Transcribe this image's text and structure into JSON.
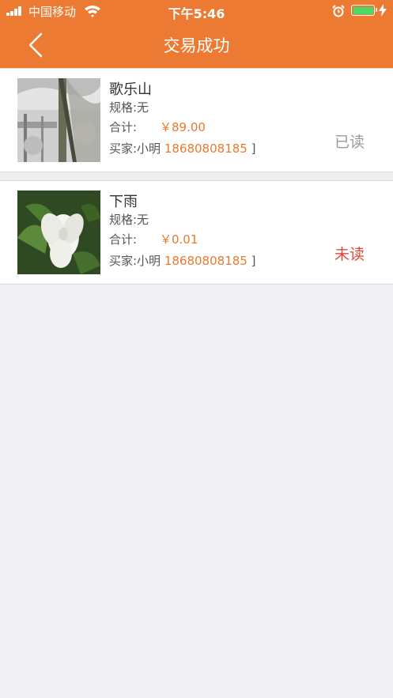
{
  "status_bar": {
    "carrier": "中国移动",
    "time": "下午5:46"
  },
  "header": {
    "title": "交易成功"
  },
  "orders": [
    {
      "name": "歌乐山",
      "spec": "规格:无",
      "total_label": "合计:",
      "price": "￥89.00",
      "buyer_label": "买家:小明",
      "buyer_phone": "18680808185",
      "buyer_suffix": "]",
      "read_status": "已读",
      "read_color": "#9a9a9a"
    },
    {
      "name": "下雨",
      "spec": "规格:无",
      "total_label": "合计:",
      "price": "￥0.01",
      "buyer_label": "买家:小明",
      "buyer_phone": "18680808185",
      "buyer_suffix": "]",
      "read_status": "未读",
      "read_color": "#e0473c"
    }
  ],
  "colors": {
    "accent": "#ec7a32",
    "price": "#e87a2f",
    "background": "#efeff4"
  }
}
